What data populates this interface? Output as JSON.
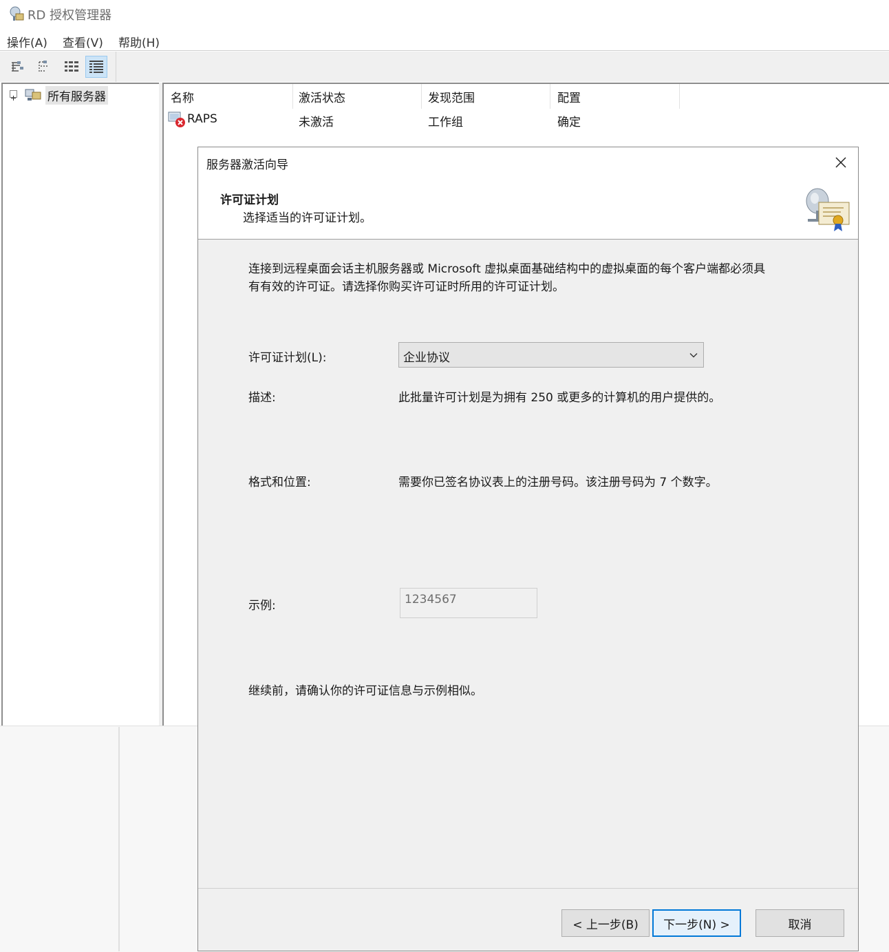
{
  "window": {
    "title": "RD 授权管理器"
  },
  "menu": {
    "items": [
      "操作(A)",
      "查看(V)",
      "帮助(H)"
    ]
  },
  "toolbar": {
    "buttons": [
      "tree-view-icon",
      "collapse-view-icon",
      "expand-view-icon",
      "details-view-icon"
    ],
    "active_index": 3
  },
  "tree": {
    "root_label": "所有服务器"
  },
  "list": {
    "columns": [
      "名称",
      "激活状态",
      "发现范围",
      "配置"
    ],
    "rows": [
      {
        "name": "RAPS",
        "status": "未激活",
        "scope": "工作组",
        "config": "确定"
      }
    ]
  },
  "dialog": {
    "title": "服务器激活向导",
    "header_title": "许可证计划",
    "header_subtitle": "选择适当的许可证计划。",
    "intro": "连接到远程桌面会话主机服务器或 Microsoft 虚拟桌面基础结构中的虚拟桌面的每个客户端都必须具有有效的许可证。请选择你购买许可证时所用的许可证计划。",
    "plan_label": "许可证计划(L):",
    "plan_value": "企业协议",
    "desc_label": "描述:",
    "desc_value": "此批量许可计划是为拥有 250 或更多的计算机的用户提供的。",
    "format_label": "格式和位置:",
    "format_value": "需要你已签名协议表上的注册号码。该注册号码为 7 个数字。",
    "example_label": "示例:",
    "example_value": "1234567",
    "confirm_text": "继续前，请确认你的许可证信息与示例相似。",
    "buttons": {
      "back": "< 上一步(B)",
      "next": "下一步(N) >",
      "cancel": "取消"
    }
  }
}
